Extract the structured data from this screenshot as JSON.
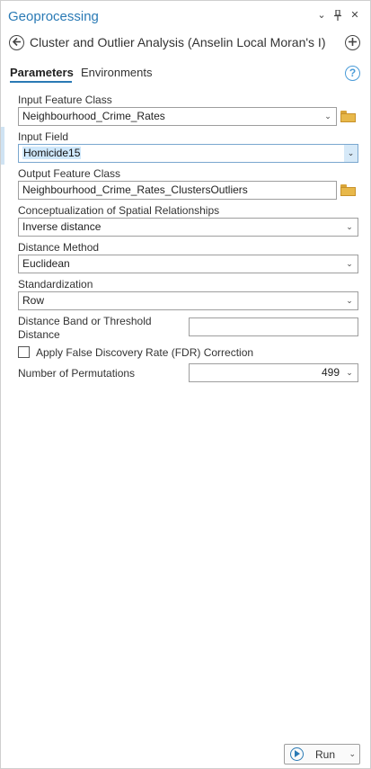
{
  "pane": {
    "title": "Geoprocessing",
    "controls": [
      "⌄",
      "⊥",
      "✕"
    ]
  },
  "tool": {
    "name": "Cluster and Outlier Analysis (Anselin Local Moran's I)"
  },
  "tabs": [
    {
      "label": "Parameters",
      "active": true
    },
    {
      "label": "Environments",
      "active": false
    }
  ],
  "params": {
    "input_feature_class": {
      "label": "Input Feature Class",
      "value": "Neighbourhood_Crime_Rates"
    },
    "input_field": {
      "label": "Input Field",
      "value": "Homicide15"
    },
    "output_feature_class": {
      "label": "Output Feature Class",
      "value": "Neighbourhood_Crime_Rates_ClustersOutliers"
    },
    "conceptualization": {
      "label": "Conceptualization of Spatial Relationships",
      "value": "Inverse distance"
    },
    "distance_method": {
      "label": "Distance Method",
      "value": "Euclidean"
    },
    "standardization": {
      "label": "Standardization",
      "value": "Row"
    },
    "distance_band": {
      "label_line1": "Distance Band or Threshold",
      "label_line2": "Distance",
      "value": ""
    },
    "fdr": {
      "label": "Apply False Discovery Rate (FDR) Correction",
      "checked": false
    },
    "permutations": {
      "label": "Number of Permutations",
      "value": "499"
    }
  },
  "run": {
    "label": "Run"
  },
  "icons": {
    "back": "back-arrow-icon",
    "add": "add-icon",
    "help": "help-icon",
    "folder": "folder-icon",
    "dropdown": "chevron-down-icon"
  },
  "colors": {
    "accent": "#2a7ab5",
    "selection": "#cfe8fb"
  }
}
